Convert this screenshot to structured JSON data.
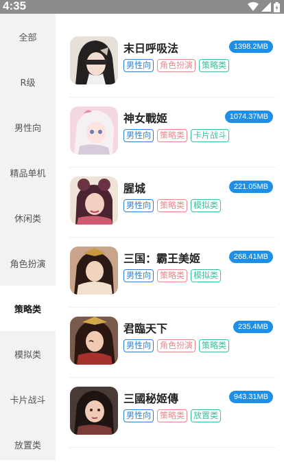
{
  "status_bar": {
    "time": "4:35"
  },
  "colors": {
    "status_bar_bg": "#8c8c8c",
    "size_badge_bg": "#1e8fe6",
    "tag_male": "#2e7fd1",
    "tag_role": "#e8888c",
    "tag_strategy_green": "#3bbf9e",
    "tag_strategy_red": "#e8888c",
    "tag_card": "#3bbf9e",
    "tag_sim": "#3bbf9e",
    "tag_idle": "#3bbf9e"
  },
  "sidebar": {
    "items": [
      {
        "label": "全部",
        "active": false
      },
      {
        "label": "R级",
        "active": false
      },
      {
        "label": "男性向",
        "active": false
      },
      {
        "label": "精品单机",
        "active": false
      },
      {
        "label": "休闲类",
        "active": false
      },
      {
        "label": "角色扮演",
        "active": false
      },
      {
        "label": "策略类",
        "active": true
      },
      {
        "label": "模拟类",
        "active": false
      },
      {
        "label": "卡片战斗",
        "active": false
      },
      {
        "label": "放置类",
        "active": false
      }
    ]
  },
  "games": [
    {
      "title": "末日呼吸法",
      "size": "1398.2MB",
      "thumb_icon": "nun-character-thumbnail",
      "tags": [
        {
          "label": "男性向",
          "color": "#2e7fd1"
        },
        {
          "label": "角色扮演",
          "color": "#e8888c"
        },
        {
          "label": "策略类",
          "color": "#3bbf9e"
        }
      ]
    },
    {
      "title": "神女戰姬",
      "size": "1074.37MB",
      "thumb_icon": "white-hair-girl-thumbnail",
      "tags": [
        {
          "label": "男性向",
          "color": "#2e7fd1"
        },
        {
          "label": "策略类",
          "color": "#e8888c"
        },
        {
          "label": "卡片战斗",
          "color": "#3bbf9e"
        }
      ]
    },
    {
      "title": "腥城",
      "size": "221.05MB",
      "thumb_icon": "goggles-girl-thumbnail",
      "tags": [
        {
          "label": "男性向",
          "color": "#2e7fd1"
        },
        {
          "label": "策略类",
          "color": "#e8888c"
        },
        {
          "label": "模拟类",
          "color": "#3bbf9e"
        }
      ]
    },
    {
      "title": "三国：霸王美姬",
      "size": "268.41MB",
      "thumb_icon": "three-kingdoms-lady-thumbnail",
      "tags": [
        {
          "label": "男性向",
          "color": "#2e7fd1"
        },
        {
          "label": "策略类",
          "color": "#e8888c"
        },
        {
          "label": "模拟类",
          "color": "#3bbf9e"
        }
      ]
    },
    {
      "title": "君臨天下",
      "size": "235.4MB",
      "thumb_icon": "empress-thumbnail",
      "tags": [
        {
          "label": "男性向",
          "color": "#2e7fd1"
        },
        {
          "label": "角色扮演",
          "color": "#e8888c"
        },
        {
          "label": "策略类",
          "color": "#3bbf9e"
        }
      ]
    },
    {
      "title": "三國秘姬傳",
      "size": "943.31MB",
      "thumb_icon": "portrait-lady-thumbnail",
      "tags": [
        {
          "label": "男性向",
          "color": "#2e7fd1"
        },
        {
          "label": "策略类",
          "color": "#e8888c"
        },
        {
          "label": "放置类",
          "color": "#3bbf9e"
        }
      ]
    }
  ]
}
